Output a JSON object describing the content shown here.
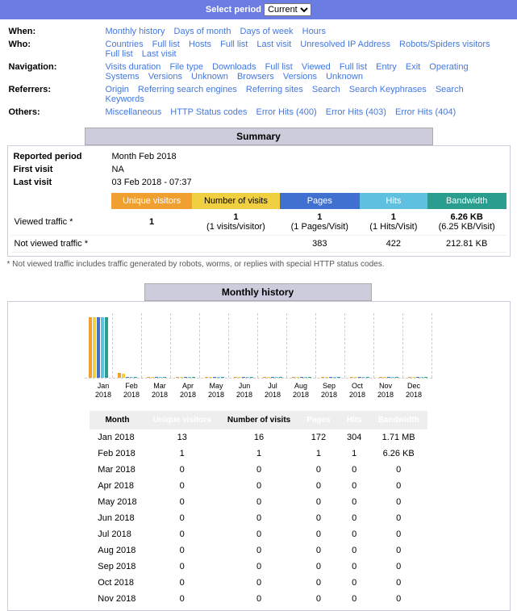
{
  "period_bar": {
    "label": "Select period",
    "selected": "Current"
  },
  "filters": {
    "when": {
      "label": "When:",
      "links": [
        "Monthly history",
        "Days of month",
        "Days of week",
        "Hours"
      ]
    },
    "who": {
      "label": "Who:",
      "links": [
        "Countries",
        "Full list",
        "Hosts",
        "Full list",
        "Last visit",
        "Unresolved IP Address",
        "Robots/Spiders visitors",
        "Full list",
        "Last visit"
      ]
    },
    "navigation": {
      "label": "Navigation:",
      "links": [
        "Visits duration",
        "File type",
        "Downloads",
        "Full list",
        "Viewed",
        "Full list",
        "Entry",
        "Exit",
        "Operating Systems",
        "Versions",
        "Unknown",
        "Browsers",
        "Versions",
        "Unknown"
      ]
    },
    "referrers": {
      "label": "Referrers:",
      "links": [
        "Origin",
        "Referring search engines",
        "Referring sites",
        "Search",
        "Search Keyphrases",
        "Search Keywords"
      ]
    },
    "others": {
      "label": "Others:",
      "links": [
        "Miscellaneous",
        "HTTP Status codes",
        "Error Hits (400)",
        "Error Hits (403)",
        "Error Hits (404)"
      ]
    }
  },
  "summary": {
    "title": "Summary",
    "reported_period_label": "Reported period",
    "reported_period": "Month Feb 2018",
    "first_visit_label": "First visit",
    "first_visit": "NA",
    "last_visit_label": "Last visit",
    "last_visit": "03 Feb 2018 - 07:37",
    "headers": {
      "uv": "Unique visitors",
      "nv": "Number of visits",
      "pg": "Pages",
      "ht": "Hits",
      "bw": "Bandwidth"
    },
    "viewed": {
      "label": "Viewed traffic *",
      "uv": "1",
      "nv": "1",
      "nv_sub": "(1 visits/visitor)",
      "pg": "1",
      "pg_sub": "(1 Pages/Visit)",
      "ht": "1",
      "ht_sub": "(1 Hits/Visit)",
      "bw": "6.26 KB",
      "bw_sub": "(6.25 KB/Visit)"
    },
    "notviewed": {
      "label": "Not viewed traffic *",
      "uv": "",
      "nv": "",
      "pg": "383",
      "ht": "422",
      "bw": "212.81 KB"
    },
    "footnote": "* Not viewed traffic includes traffic generated by robots, worms, or replies with special HTTP status codes."
  },
  "monthly": {
    "title": "Monthly history",
    "headers": {
      "month": "Month",
      "uv": "Unique visitors",
      "nv": "Number of visits",
      "pg": "Pages",
      "ht": "Hits",
      "bw": "Bandwidth"
    },
    "rows": [
      {
        "m": "Jan 2018",
        "uv": "13",
        "nv": "16",
        "pg": "172",
        "ht": "304",
        "bw": "1.71 MB"
      },
      {
        "m": "Feb 2018",
        "uv": "1",
        "nv": "1",
        "pg": "1",
        "ht": "1",
        "bw": "6.26 KB"
      },
      {
        "m": "Mar 2018",
        "uv": "0",
        "nv": "0",
        "pg": "0",
        "ht": "0",
        "bw": "0"
      },
      {
        "m": "Apr 2018",
        "uv": "0",
        "nv": "0",
        "pg": "0",
        "ht": "0",
        "bw": "0"
      },
      {
        "m": "May 2018",
        "uv": "0",
        "nv": "0",
        "pg": "0",
        "ht": "0",
        "bw": "0"
      },
      {
        "m": "Jun 2018",
        "uv": "0",
        "nv": "0",
        "pg": "0",
        "ht": "0",
        "bw": "0"
      },
      {
        "m": "Jul 2018",
        "uv": "0",
        "nv": "0",
        "pg": "0",
        "ht": "0",
        "bw": "0"
      },
      {
        "m": "Aug 2018",
        "uv": "0",
        "nv": "0",
        "pg": "0",
        "ht": "0",
        "bw": "0"
      },
      {
        "m": "Sep 2018",
        "uv": "0",
        "nv": "0",
        "pg": "0",
        "ht": "0",
        "bw": "0"
      },
      {
        "m": "Oct 2018",
        "uv": "0",
        "nv": "0",
        "pg": "0",
        "ht": "0",
        "bw": "0"
      },
      {
        "m": "Nov 2018",
        "uv": "0",
        "nv": "0",
        "pg": "0",
        "ht": "0",
        "bw": "0"
      }
    ]
  },
  "chart_data": {
    "type": "bar",
    "categories": [
      "Jan 2018",
      "Feb 2018",
      "Mar 2018",
      "Apr 2018",
      "May 2018",
      "Jun 2018",
      "Jul 2018",
      "Aug 2018",
      "Sep 2018",
      "Oct 2018",
      "Nov 2018",
      "Dec 2018"
    ],
    "series": [
      {
        "name": "Unique visitors",
        "values": [
          13,
          1,
          0,
          0,
          0,
          0,
          0,
          0,
          0,
          0,
          0,
          0
        ]
      },
      {
        "name": "Number of visits",
        "values": [
          16,
          1,
          0,
          0,
          0,
          0,
          0,
          0,
          0,
          0,
          0,
          0
        ]
      },
      {
        "name": "Pages",
        "values": [
          172,
          1,
          0,
          0,
          0,
          0,
          0,
          0,
          0,
          0,
          0,
          0
        ]
      },
      {
        "name": "Hits",
        "values": [
          304,
          1,
          0,
          0,
          0,
          0,
          0,
          0,
          0,
          0,
          0,
          0
        ]
      },
      {
        "name": "Bandwidth (KB)",
        "values": [
          1751,
          6.26,
          0,
          0,
          0,
          0,
          0,
          0,
          0,
          0,
          0,
          0
        ]
      }
    ],
    "title": "Monthly history"
  }
}
